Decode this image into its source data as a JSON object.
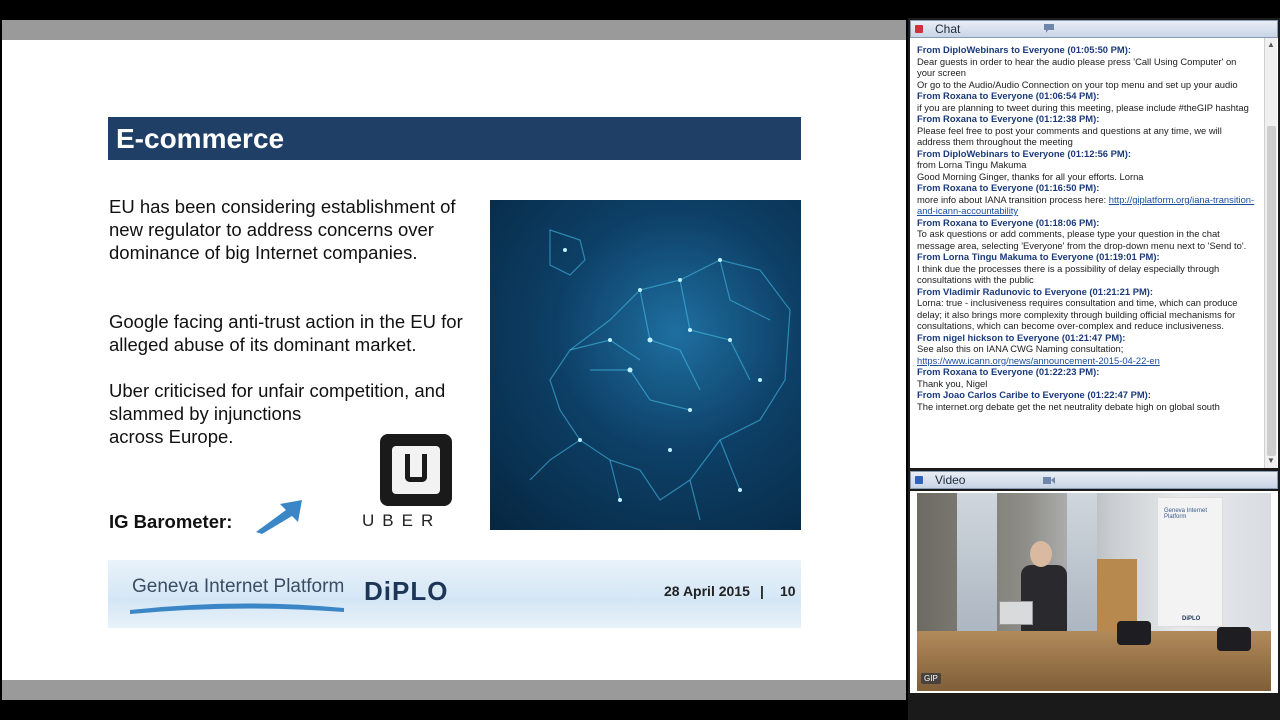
{
  "slide": {
    "title": "E-commerce",
    "paragraph1": "EU has been considering establishment of new regulator to address concerns over dominance of big Internet companies.",
    "paragraph2": "Google facing anti-trust action in the EU for alleged abuse of its dominant market.",
    "paragraph3_line1": "Uber criticised for unfair competition, and",
    "paragraph3_line2": "slammed by injunctions",
    "paragraph3_line3": "across Europe.",
    "barometer_label": "IG Barometer:",
    "uber_wordmark": "UBER",
    "footer": {
      "gip_logo": "Geneva Internet Platform",
      "diplo_logo": "DiPLO",
      "date": "28 April 2015",
      "separator": "|",
      "page_number": "10"
    },
    "colors": {
      "title_bar": "#1f3f66",
      "footer_strip": "#d4e6f5",
      "barometer_arrow": "#3b86c6"
    }
  },
  "chat_panel": {
    "title": "Chat",
    "messages": [
      {
        "from": "From DiploWebinars to Everyone (01:05:50 PM):",
        "text": "Dear guests in order to hear the audio please press 'Call Using Computer' on your screen\nOr go to the Audio/Audio Connection on your top menu and set up your audio"
      },
      {
        "from": "From Roxana to Everyone (01:06:54 PM):",
        "text": "if you are planning to tweet during this meeting, please include #theGIP hashtag"
      },
      {
        "from": "From Roxana to Everyone (01:12:38 PM):",
        "text": "Please feel free to post your comments and questions at any time, we will address them throughout the meeting"
      },
      {
        "from": "From DiploWebinars to Everyone (01:12:56 PM):",
        "text": "from Lorna Tingu Makuma\nGood Morning Ginger, thanks for all your efforts.  Lorna"
      },
      {
        "from": "From Roxana to Everyone (01:16:50 PM):",
        "text": "more info about IANA transition process here: ",
        "link": "http://giplatform.org/iana-transition-and-icann-accountability"
      },
      {
        "from": "From Roxana to Everyone (01:18:06 PM):",
        "text": "To ask questions or add comments, please type your question in the chat message area, selecting 'Everyone' from the drop-down menu next to 'Send to'."
      },
      {
        "from": "From Lorna Tingu Makuma to Everyone (01:19:01 PM):",
        "text": "I think due the processes there is a possibility of delay especially through consultations with the public"
      },
      {
        "from": "From Vladimir Radunovic to Everyone (01:21:21 PM):",
        "text": "Lorna: true - inclusiveness requires consultation and time, which can produce delay; it also brings more complexity through building official mechanisms for consultations, which can become over-complex and reduce inclusiveness."
      },
      {
        "from": "From nigel hickson to Everyone (01:21:47 PM):",
        "text": "See also this on IANA CWG Naming consultation;",
        "link": "https://www.icann.org/news/announcement-2015-04-22-en"
      },
      {
        "from": "From Roxana to Everyone (01:22:23 PM):",
        "text": "Thank you, Nigel"
      },
      {
        "from": "From Joao Carlos Caribe to Everyone (01:22:47 PM):",
        "text": "The internet.org debate get the net neutrality debate high on global south"
      }
    ]
  },
  "video_panel": {
    "title": "Video",
    "badge": "GIP",
    "banner_text": "Geneva Internet Platform",
    "banner_logo": "DiPLO"
  },
  "icons": {
    "chat_pin": "pin-icon",
    "chat_header": "speech-bubble-icon",
    "video_pin": "pin-icon",
    "video_header": "camera-icon",
    "scroll_up": "arrow-up-icon",
    "scroll_down": "arrow-down-icon"
  }
}
